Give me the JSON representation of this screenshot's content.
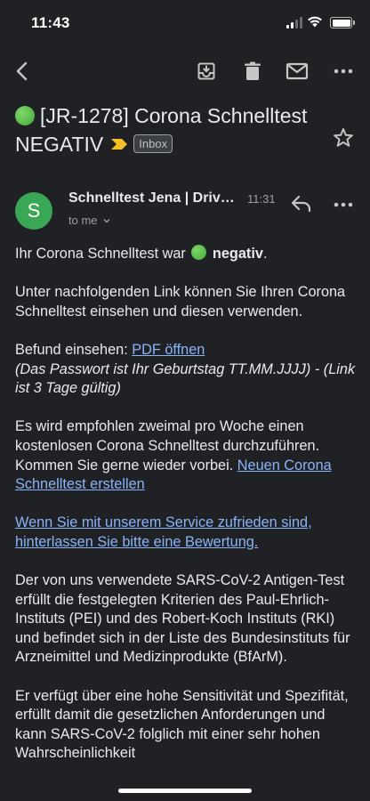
{
  "status_bar": {
    "time": "11:43",
    "icons": [
      "signal-icon",
      "wifi-icon",
      "battery-icon"
    ]
  },
  "toolbar": {
    "icons": [
      "back-arrow-icon",
      "archive-icon",
      "trash-icon",
      "mail-unread-icon",
      "more-horizontal-icon"
    ]
  },
  "email": {
    "subject_part1": "[JR-1278] Corona Schnelltest",
    "subject_part2": "NEGATIV",
    "label": "Inbox",
    "sender": {
      "avatar_letter": "S",
      "name": "Schnelltest Jena | Drive...",
      "time": "11:31",
      "recipient": "to me"
    },
    "body": {
      "intro_prefix": "Ihr Corona Schnelltest war",
      "intro_bold": "negativ",
      "intro_suffix": ".",
      "link_paragraph": "Unter nachfolgenden Link können Sie Ihren Corona Schnelltest einsehen und diesen verwenden.",
      "befund_label": "Befund einsehen:",
      "pdf_link": "PDF öffnen",
      "password_note": "(Das Passwort ist Ihr Geburtstag TT.MM.JJJJ) - (Link ist 3 Tage gültig)",
      "recommend_text": "Es wird empfohlen zweimal pro Woche einen kostenlosen Corona Schnelltest durchzuführen. Kommen Sie gerne wieder vorbei.",
      "new_test_link": "Neuen Corona Schnelltest erstellen",
      "review_link": "Wenn Sie mit unserem Service zufrieden sind, hinterlassen Sie bitte eine Bewertung.",
      "antigen_paragraph": "Der von uns verwendete SARS-CoV-2 Antigen-Test erfüllt die festgelegten Kriterien des Paul-Ehrlich-Instituts (PEI) und des Robert-Koch Instituts (RKI) und befindet sich in der Liste des Bundesinstituts für Arzneimittel und Medizinprodukte (BfArM).",
      "sensitivity_paragraph": "Er verfügt über eine hohe Sensitivität und Spezifität, erfüllt damit die gesetzlichen Anforderungen und kann SARS-CoV-2 folglich mit einer sehr hohen Wahrscheinlichkeit"
    }
  },
  "colors": {
    "background": "#202124",
    "text": "#e8eaed",
    "link": "#8ab4f8",
    "avatar": "#3aa757",
    "important_marker": "#f6bf26",
    "status_green": "#4caf50"
  }
}
